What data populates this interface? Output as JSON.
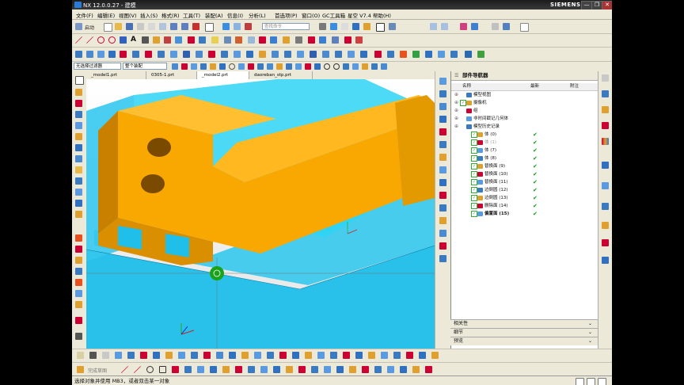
{
  "window": {
    "title": "NX 12.0.0.27 - 建模",
    "brand": "SIEMENS",
    "controls": [
      "—",
      "❐",
      "✕"
    ]
  },
  "menu": [
    "文件(F)",
    "编辑(E)",
    "视图(V)",
    "插入(S)",
    "格式(R)",
    "工具(T)",
    "装配(A)",
    "信息(I)",
    "分析(L)",
    "首选项(P)",
    "窗口(O)",
    "GC工具箱",
    "星空 V7.4",
    "帮助(H)"
  ],
  "toolbar": {
    "start_label": "启动",
    "search_placeholder": "查找命令",
    "filter_select": "无选择过滤器",
    "assembly_select": "整个装配"
  },
  "tabs": [
    {
      "label": "_model1.prt",
      "active": false
    },
    {
      "label": "0305-1.prt",
      "active": false
    },
    {
      "label": "_model2.prt",
      "active": true
    },
    {
      "label": "daoreban_stp.prt",
      "active": false
    }
  ],
  "navigator": {
    "title": "部件导航器",
    "columns": [
      "名称",
      "最新",
      "附注"
    ],
    "items": [
      {
        "label": "模型视图",
        "indent": 0,
        "checked": false,
        "latest": false,
        "bold": false,
        "gray": false
      },
      {
        "label": "摄像机",
        "indent": 0,
        "checked": true,
        "latest": false,
        "bold": false,
        "gray": false
      },
      {
        "label": "组",
        "indent": 0,
        "checked": false,
        "latest": false,
        "bold": false,
        "gray": false
      },
      {
        "label": "非时间戳记几何体",
        "indent": 0,
        "checked": false,
        "latest": false,
        "bold": false,
        "gray": false
      },
      {
        "label": "模型历史记录",
        "indent": 0,
        "checked": false,
        "latest": false,
        "bold": false,
        "gray": false
      },
      {
        "label": "体 (0)",
        "indent": 1,
        "checked": true,
        "latest": true,
        "bold": false,
        "gray": false
      },
      {
        "label": "体 (1)",
        "indent": 1,
        "checked": true,
        "latest": true,
        "bold": false,
        "gray": true
      },
      {
        "label": "体 (7)",
        "indent": 1,
        "checked": true,
        "latest": true,
        "bold": false,
        "gray": false
      },
      {
        "label": "体 (8)",
        "indent": 1,
        "checked": true,
        "latest": true,
        "bold": false,
        "gray": false
      },
      {
        "label": "替换面 (9)",
        "indent": 1,
        "checked": true,
        "latest": true,
        "bold": false,
        "gray": false
      },
      {
        "label": "替换面 (10)",
        "indent": 1,
        "checked": true,
        "latest": true,
        "bold": false,
        "gray": false
      },
      {
        "label": "替换面 (11)",
        "indent": 1,
        "checked": true,
        "latest": true,
        "bold": false,
        "gray": false
      },
      {
        "label": "边倒圆 (12)",
        "indent": 1,
        "checked": true,
        "latest": true,
        "bold": false,
        "gray": false
      },
      {
        "label": "边倒圆 (13)",
        "indent": 1,
        "checked": true,
        "latest": true,
        "bold": false,
        "gray": false
      },
      {
        "label": "删除面 (14)",
        "indent": 1,
        "checked": true,
        "latest": true,
        "bold": false,
        "gray": false
      },
      {
        "label": "偏置面 (15)",
        "indent": 1,
        "checked": true,
        "latest": true,
        "bold": true,
        "gray": false
      }
    ],
    "panels": [
      "相关性",
      "细节",
      "预览"
    ]
  },
  "bottom_toolbar": {
    "sketch_label": "完成草图"
  },
  "status": {
    "message": "选择对象并使用 MB3，或者双击某一对象"
  },
  "colors": {
    "body_orange": "#f8a800",
    "body_cyan": "#2ed3f5",
    "check_green": "#119911",
    "accent_blue": "#2b7bd6"
  }
}
